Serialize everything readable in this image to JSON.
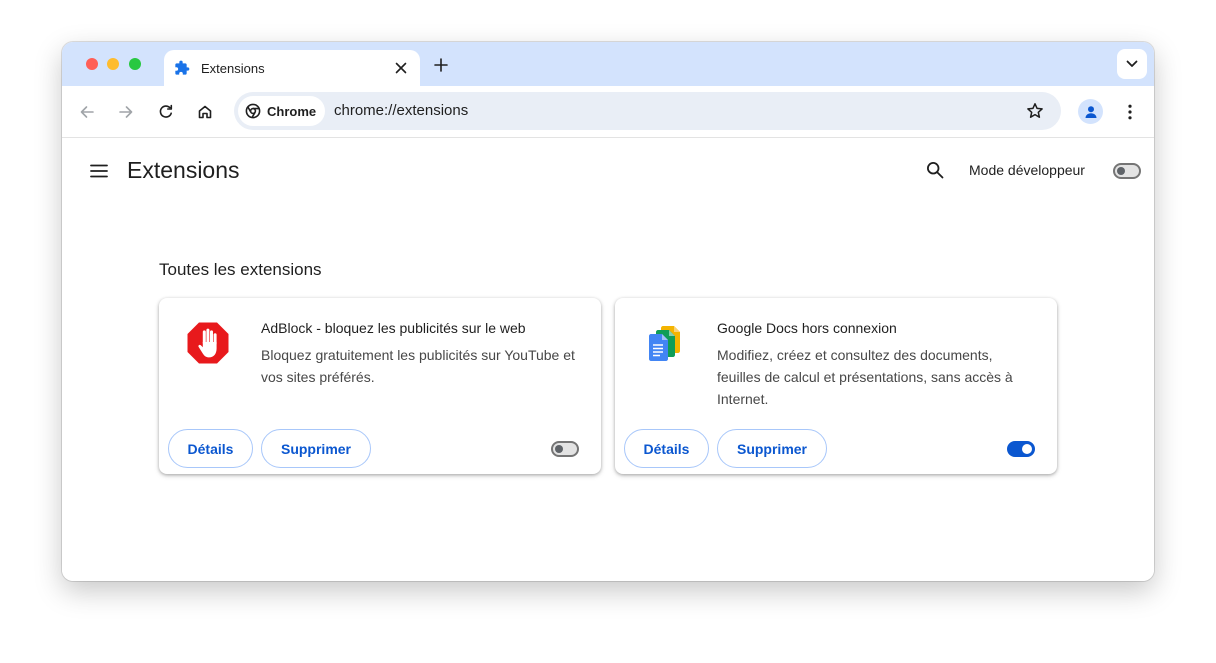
{
  "tab": {
    "title": "Extensions",
    "icon": "puzzle-icon"
  },
  "omnibox": {
    "chip_label": "Chrome",
    "url": "chrome://extensions"
  },
  "page": {
    "title": "Extensions",
    "dev_mode_label": "Mode développeur",
    "dev_mode_enabled": false,
    "section_title": "Toutes les extensions"
  },
  "extensions": [
    {
      "name": "AdBlock - bloquez les publicités sur le web",
      "description": "Bloquez gratuitement les publicités sur YouTube et vos sites préférés.",
      "details_label": "Détails",
      "remove_label": "Supprimer",
      "enabled": false,
      "icon": "adblock-icon"
    },
    {
      "name": "Google Docs hors connexion",
      "description": "Modifiez, créez et consultez des documents, feuilles de calcul et présentations, sans accès à Internet.",
      "details_label": "Détails",
      "remove_label": "Supprimer",
      "enabled": true,
      "icon": "google-docs-icon"
    }
  ],
  "colors": {
    "tabstrip": "#d3e3fd",
    "accent": "#0b57d0",
    "adblock_red": "#e8191c",
    "docs_blue": "#4285f4",
    "sheets_green": "#0f9d58",
    "slides_yellow": "#f4b400"
  }
}
